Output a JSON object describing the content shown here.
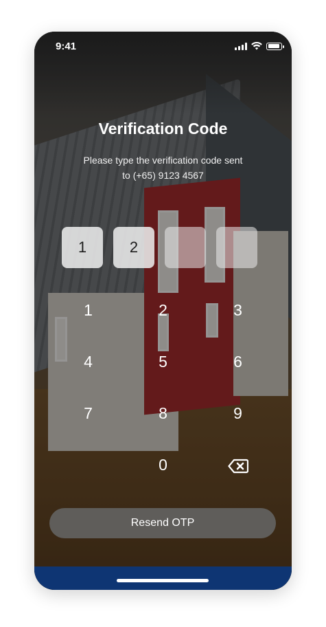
{
  "status_bar": {
    "time": "9:41"
  },
  "header": {
    "title": "Verification Code",
    "subtitle_line1": "Please type the verification code sent",
    "subtitle_line2": "to (+65) 9123 4567"
  },
  "otp": {
    "digits": [
      "1",
      "2",
      "",
      ""
    ]
  },
  "keypad": {
    "keys": [
      "1",
      "2",
      "3",
      "4",
      "5",
      "6",
      "7",
      "8",
      "9",
      "",
      "0",
      "backspace-icon"
    ]
  },
  "actions": {
    "resend_label": "Resend OTP"
  },
  "colors": {
    "bottom_bar": "#0e3573",
    "resend_button": "#646464"
  }
}
